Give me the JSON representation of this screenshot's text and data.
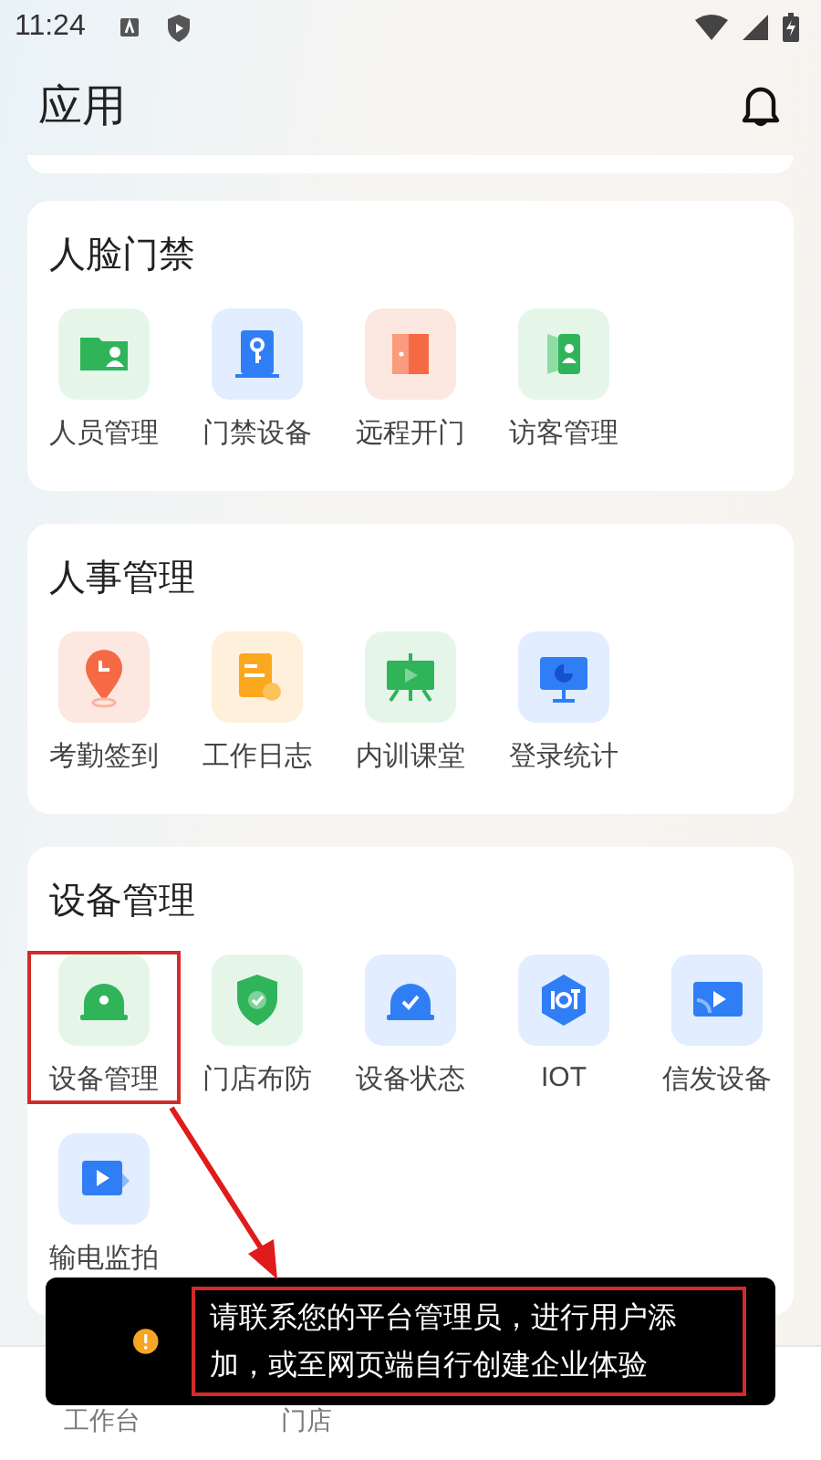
{
  "status_bar": {
    "time": "11:24"
  },
  "header": {
    "title": "应用"
  },
  "sections": [
    {
      "title": "人脸门禁",
      "items": [
        {
          "label": "人员管理",
          "kind": "id-card",
          "highlighted": false
        },
        {
          "label": "门禁设备",
          "kind": "key-door",
          "highlighted": false
        },
        {
          "label": "远程开门",
          "kind": "door",
          "highlighted": false
        },
        {
          "label": "访客管理",
          "kind": "visitor",
          "highlighted": false
        }
      ]
    },
    {
      "title": "人事管理",
      "items": [
        {
          "label": "考勤签到",
          "kind": "pin-clock",
          "highlighted": false
        },
        {
          "label": "工作日志",
          "kind": "log",
          "highlighted": false
        },
        {
          "label": "内训课堂",
          "kind": "easel",
          "highlighted": false
        },
        {
          "label": "登录统计",
          "kind": "monitor",
          "highlighted": false
        }
      ]
    },
    {
      "title": "设备管理",
      "items": [
        {
          "label": "设备管理",
          "kind": "helmet",
          "highlighted": true
        },
        {
          "label": "门店布防",
          "kind": "shield",
          "highlighted": false
        },
        {
          "label": "设备状态",
          "kind": "helmet-check",
          "highlighted": false
        },
        {
          "label": "IOT",
          "kind": "iot",
          "highlighted": false
        },
        {
          "label": "信发设备",
          "kind": "cast",
          "highlighted": false
        },
        {
          "label": "输电监拍",
          "kind": "video",
          "highlighted": false
        }
      ]
    }
  ],
  "toast": {
    "text": "请联系您的平台管理员，进行用户添加，或至网页端自行创建企业体验",
    "highlighted": true
  },
  "nav": [
    {
      "label": "工作台"
    },
    {
      "label": "门店"
    }
  ]
}
